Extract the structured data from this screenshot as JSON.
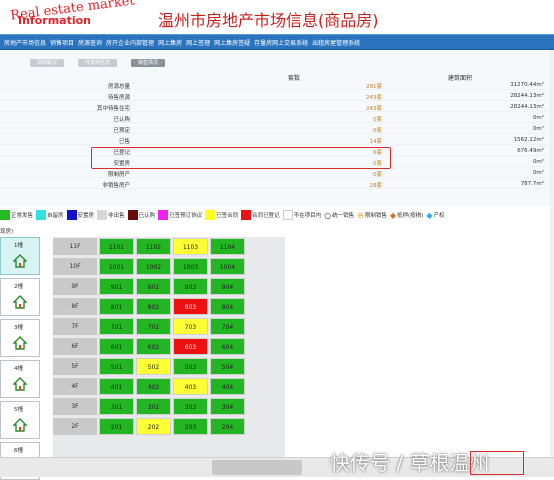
{
  "header": {
    "logo_line1": "Real estate market",
    "logo_line2": "Information",
    "title": "温州市房地产市场信息(商品房)"
  },
  "nav": {
    "items": [
      "房地产市场信息",
      "销售项目",
      "房源查询",
      "房开企业内部管理",
      "网上集房",
      "网上签理",
      "网上集房签疑",
      "存量房网上交易系统",
      "出租房屋管理系统"
    ]
  },
  "tabs": {
    "items": [
      "项目概况",
      "开发商信息",
      "销售情况"
    ]
  },
  "stats": {
    "header_count": "套数",
    "header_area": "建筑面积",
    "rows": [
      {
        "label": "房源总量",
        "count": "291套",
        "area": "31270.44m²"
      },
      {
        "label": "待售房源",
        "count": "243套",
        "area": "28244.13m²"
      },
      {
        "label": "其中待售住宅",
        "count": "243套",
        "area": "28244.13m²"
      },
      {
        "label": "已认购",
        "count": "0套",
        "area": "0m²"
      },
      {
        "label": "已预定",
        "count": "0套",
        "area": "0m²"
      },
      {
        "label": "已售",
        "count": "14套",
        "area": "1562.12m²"
      },
      {
        "label": "已登记",
        "count": "6套",
        "area": "676.49m²"
      },
      {
        "label": "安置房",
        "count": "0套",
        "area": "0m²"
      },
      {
        "label": "限制房产",
        "count": "0套",
        "area": "0m²"
      },
      {
        "label": "非销售房产",
        "count": "28套",
        "area": "787.7m²"
      }
    ]
  },
  "legend": [
    {
      "label": "正常发售",
      "color": "#22bb22"
    },
    {
      "label": "自留房",
      "color": "#33e0e0"
    },
    {
      "label": "安置房",
      "color": "#1111cc"
    },
    {
      "label": "非出售",
      "color": "#d8d8d8"
    },
    {
      "label": "已认购",
      "color": "#6b0b0b"
    },
    {
      "label": "已签预订协议",
      "color": "#ee22ee"
    },
    {
      "label": "已签合同",
      "color": "#ffff22"
    },
    {
      "label": "合同已登记",
      "color": "#ee1111"
    },
    {
      "label": "不在项目内",
      "color": "#ffffff"
    }
  ],
  "legend_icons": [
    {
      "label": "统一销售",
      "icon": "circle-icon"
    },
    {
      "label": "限制销售",
      "icon": "ring-icon"
    },
    {
      "label": "抵押(按揭)",
      "icon": "diamond-icon"
    },
    {
      "label": "产权",
      "icon": "dot-icon"
    }
  ],
  "unit_label": "现房)",
  "buildings": [
    {
      "label": "1幢"
    },
    {
      "label": "2幢"
    },
    {
      "label": "3幢"
    },
    {
      "label": "4幢"
    },
    {
      "label": "5幢"
    },
    {
      "label": "6幢"
    }
  ],
  "colors": {
    "green": "#22b722",
    "yellow": "#ffff33",
    "red": "#ee1111"
  },
  "floors": [
    {
      "floor": "11F",
      "units": [
        {
          "no": "1101",
          "s": "green"
        },
        {
          "no": "1102",
          "s": "green"
        },
        {
          "no": "1103",
          "s": "yellow"
        },
        {
          "no": "1104",
          "s": "green"
        }
      ]
    },
    {
      "floor": "10F",
      "units": [
        {
          "no": "1001",
          "s": "green"
        },
        {
          "no": "1002",
          "s": "green"
        },
        {
          "no": "1003",
          "s": "green"
        },
        {
          "no": "1004",
          "s": "green"
        }
      ]
    },
    {
      "floor": "9F",
      "units": [
        {
          "no": "901",
          "s": "green"
        },
        {
          "no": "902",
          "s": "green"
        },
        {
          "no": "903",
          "s": "green"
        },
        {
          "no": "904",
          "s": "green"
        }
      ]
    },
    {
      "floor": "8F",
      "units": [
        {
          "no": "801",
          "s": "green"
        },
        {
          "no": "802",
          "s": "green"
        },
        {
          "no": "803",
          "s": "red"
        },
        {
          "no": "804",
          "s": "green"
        }
      ]
    },
    {
      "floor": "7F",
      "units": [
        {
          "no": "701",
          "s": "green"
        },
        {
          "no": "702",
          "s": "green"
        },
        {
          "no": "703",
          "s": "yellow"
        },
        {
          "no": "704",
          "s": "green"
        }
      ]
    },
    {
      "floor": "6F",
      "units": [
        {
          "no": "601",
          "s": "green"
        },
        {
          "no": "602",
          "s": "green"
        },
        {
          "no": "603",
          "s": "red"
        },
        {
          "no": "604",
          "s": "green"
        }
      ]
    },
    {
      "floor": "5F",
      "units": [
        {
          "no": "501",
          "s": "green"
        },
        {
          "no": "502",
          "s": "yellow"
        },
        {
          "no": "503",
          "s": "green"
        },
        {
          "no": "504",
          "s": "green"
        }
      ]
    },
    {
      "floor": "4F",
      "units": [
        {
          "no": "401",
          "s": "green"
        },
        {
          "no": "402",
          "s": "green"
        },
        {
          "no": "403",
          "s": "yellow"
        },
        {
          "no": "404",
          "s": "green"
        }
      ]
    },
    {
      "floor": "3F",
      "units": [
        {
          "no": "301",
          "s": "green"
        },
        {
          "no": "302",
          "s": "green"
        },
        {
          "no": "303",
          "s": "green"
        },
        {
          "no": "304",
          "s": "green"
        }
      ]
    },
    {
      "floor": "2F",
      "units": [
        {
          "no": "201",
          "s": "green"
        },
        {
          "no": "202",
          "s": "yellow"
        },
        {
          "no": "203",
          "s": "green"
        },
        {
          "no": "204",
          "s": "green"
        }
      ]
    }
  ],
  "watermark": "快传号 / 草根温州"
}
